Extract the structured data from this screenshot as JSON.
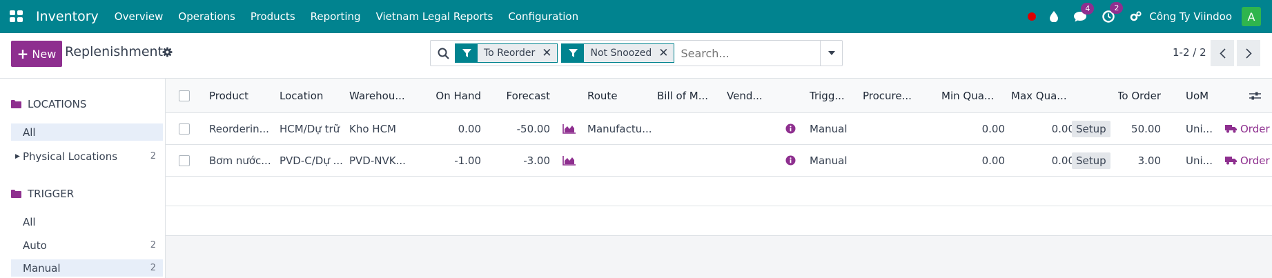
{
  "navbar": {
    "app_name": "Inventory",
    "menu": [
      "Overview",
      "Operations",
      "Products",
      "Reporting",
      "Vietnam Legal Reports",
      "Configuration"
    ],
    "messages_count": "4",
    "activities_count": "2",
    "company": "Công Ty Viindoo",
    "avatar_letter": "A",
    "colors": {
      "bar": "#01838f",
      "accent": "#8e2f8f",
      "avatar": "#2fb54d",
      "recording": "#dd0000"
    }
  },
  "control": {
    "new_label": "New",
    "title": "Replenishment",
    "filters": [
      "To Reorder",
      "Not Snoozed"
    ],
    "search_placeholder": "Search...",
    "pager": "1-2 / 2"
  },
  "sidebar": {
    "sections": [
      {
        "title": "LOCATIONS",
        "icon": "folder-icon"
      },
      {
        "title": "TRIGGER",
        "icon": "folder-icon"
      }
    ],
    "locations": [
      {
        "label": "All",
        "count": "",
        "active": true
      },
      {
        "label": "Physical Locations",
        "count": "2",
        "active": false
      }
    ],
    "trigger": [
      {
        "label": "All",
        "count": "",
        "active": false
      },
      {
        "label": "Auto",
        "count": "2",
        "active": false
      },
      {
        "label": "Manual",
        "count": "2",
        "active": true
      }
    ]
  },
  "table": {
    "columns": [
      "Product",
      "Location",
      "Warehou...",
      "On Hand",
      "Forecast",
      "Route",
      "Bill of M...",
      "Vend...",
      "Trigg...",
      "Procure...",
      "Min Qua...",
      "Max Qua...",
      "To Order",
      "UoM"
    ],
    "rows": [
      {
        "product": "Reorderin...",
        "location": "HCM/Dự trữ",
        "warehouse": "Kho HCM",
        "on_hand": "0.00",
        "forecast": "-50.00",
        "route": "Manufactu...",
        "bom": "",
        "vendor": "",
        "trigger": "Manual",
        "procurement": "",
        "min_qty": "0.00",
        "max_qty": "0.00",
        "setup": "Setup",
        "to_order": "50.00",
        "uom": "Uni...",
        "order": "Order"
      },
      {
        "product": "Bơm nước...",
        "location": "PVD-C/Dự ...",
        "warehouse": "PVD-NVK...",
        "on_hand": "-1.00",
        "forecast": "-3.00",
        "route": "",
        "bom": "",
        "vendor": "",
        "trigger": "Manual",
        "procurement": "",
        "min_qty": "0.00",
        "max_qty": "0.00",
        "setup": "Setup",
        "to_order": "3.00",
        "uom": "Uni...",
        "order": "Order"
      }
    ]
  }
}
